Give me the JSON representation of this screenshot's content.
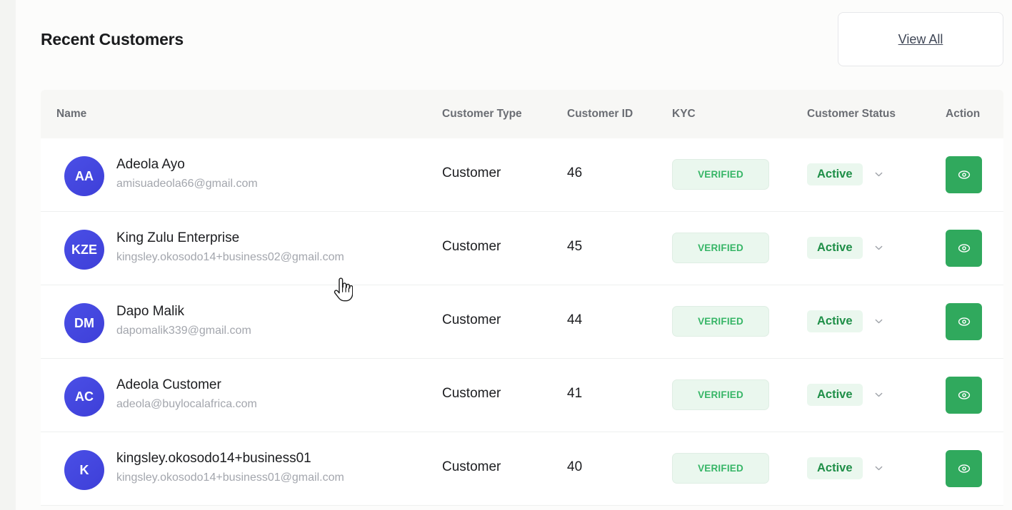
{
  "header": {
    "title": "Recent Customers",
    "view_all_label": "View All"
  },
  "table": {
    "columns": {
      "name": "Name",
      "customer_type": "Customer Type",
      "customer_id": "Customer ID",
      "kyc": "KYC",
      "customer_status": "Customer Status",
      "action": "Action"
    },
    "rows": [
      {
        "initials": "AA",
        "name": "Adeola Ayo",
        "email": "amisuadeola66@gmail.com",
        "type": "Customer",
        "id": "46",
        "kyc": "VERIFIED",
        "status": "Active"
      },
      {
        "initials": "KZE",
        "name": "King Zulu Enterprise",
        "email": "kingsley.okosodo14+business02@gmail.com",
        "type": "Customer",
        "id": "45",
        "kyc": "VERIFIED",
        "status": "Active"
      },
      {
        "initials": "DM",
        "name": "Dapo Malik",
        "email": "dapomalik339@gmail.com",
        "type": "Customer",
        "id": "44",
        "kyc": "VERIFIED",
        "status": "Active"
      },
      {
        "initials": "AC",
        "name": "Adeola Customer",
        "email": "adeola@buylocalafrica.com",
        "type": "Customer",
        "id": "41",
        "kyc": "VERIFIED",
        "status": "Active"
      },
      {
        "initials": "K",
        "name": "kingsley.okosodo14+business01",
        "email": "kingsley.okosodo14+business01@gmail.com",
        "type": "Customer",
        "id": "40",
        "kyc": "VERIFIED",
        "status": "Active"
      }
    ]
  },
  "icons": {
    "view": "eye-icon",
    "status_dropdown": "chevron-down-icon",
    "cursor": "hand-pointer-icon"
  },
  "colors": {
    "avatar": "#4446e0",
    "action_button": "#30a95d",
    "verified_text": "#36b566",
    "active_text": "#1f8f48",
    "badge_background": "#eaf7ee"
  }
}
